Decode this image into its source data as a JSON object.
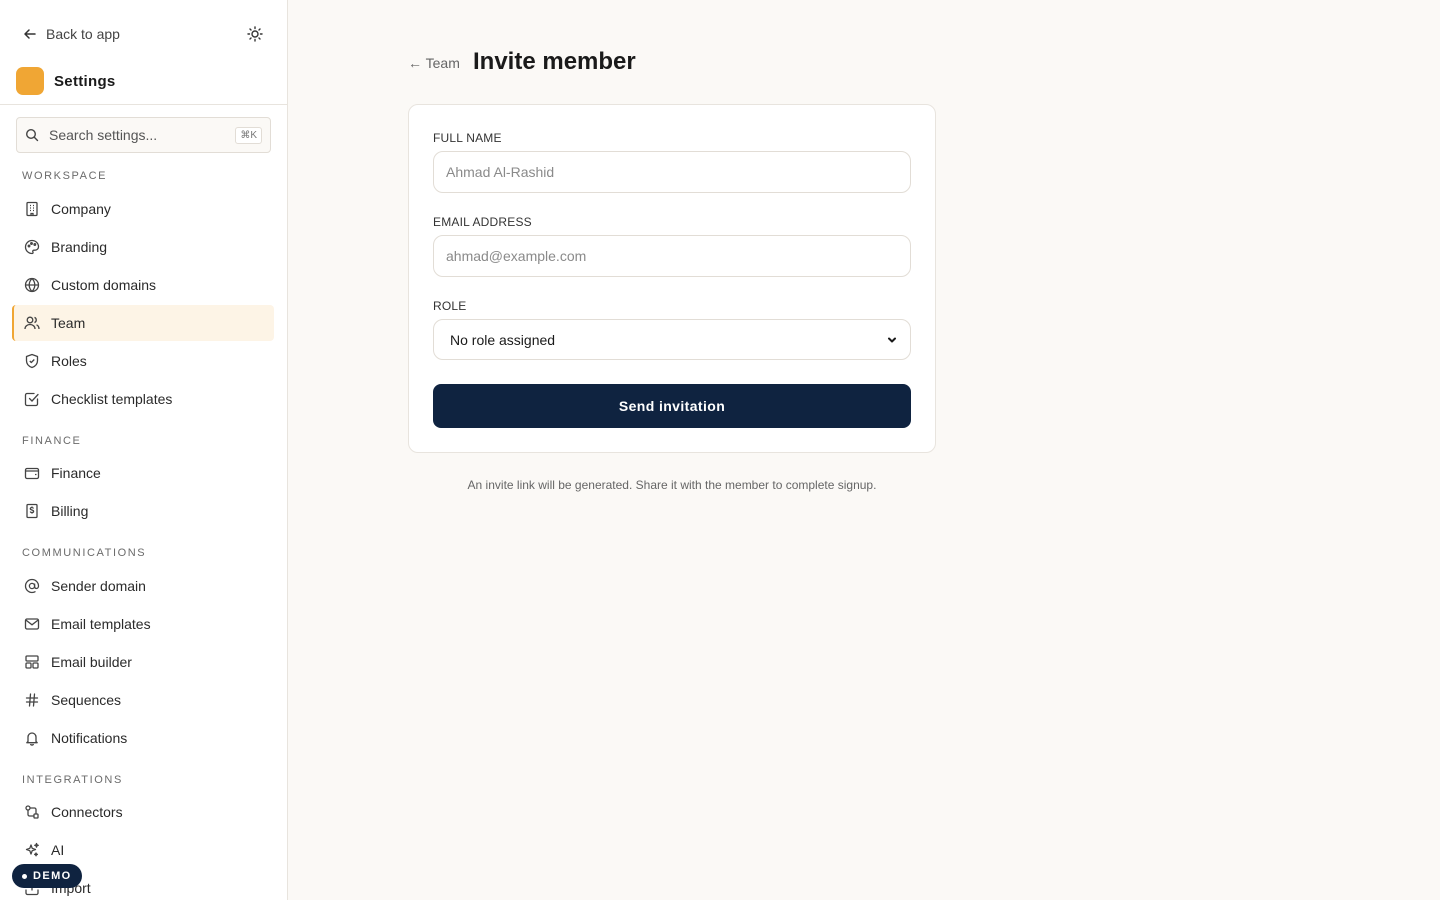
{
  "sidebar": {
    "back_label": "Back to app",
    "brand_title": "Settings",
    "search_placeholder": "Search settings...",
    "search_shortcut": "⌘K",
    "sections": [
      {
        "label": "WORKSPACE",
        "items": [
          {
            "label": "Company",
            "icon": "building-icon"
          },
          {
            "label": "Branding",
            "icon": "palette-icon"
          },
          {
            "label": "Custom domains",
            "icon": "globe-icon"
          },
          {
            "label": "Team",
            "icon": "users-icon",
            "active": true
          },
          {
            "label": "Roles",
            "icon": "shield-icon"
          },
          {
            "label": "Checklist templates",
            "icon": "checkbox-icon"
          }
        ]
      },
      {
        "label": "FINANCE",
        "items": [
          {
            "label": "Finance",
            "icon": "wallet-icon"
          },
          {
            "label": "Billing",
            "icon": "receipt-icon"
          }
        ]
      },
      {
        "label": "COMMUNICATIONS",
        "items": [
          {
            "label": "Sender domain",
            "icon": "at-sign-icon"
          },
          {
            "label": "Email templates",
            "icon": "mail-icon"
          },
          {
            "label": "Email builder",
            "icon": "layout-icon"
          },
          {
            "label": "Sequences",
            "icon": "hash-icon"
          },
          {
            "label": "Notifications",
            "icon": "bell-icon"
          }
        ]
      },
      {
        "label": "INTEGRATIONS",
        "items": [
          {
            "label": "Connectors",
            "icon": "connector-icon"
          },
          {
            "label": "AI",
            "icon": "sparkles-icon"
          },
          {
            "label": "Import",
            "icon": "upload-icon"
          }
        ]
      }
    ],
    "demo_label": "DEMO"
  },
  "main": {
    "breadcrumb": "← Team",
    "title": "Invite member",
    "form": {
      "full_name_label": "FULL NAME",
      "full_name_placeholder": "Ahmad Al-Rashid",
      "email_label": "EMAIL ADDRESS",
      "email_placeholder": "ahmad@example.com",
      "role_label": "ROLE",
      "role_value": "No role assigned",
      "submit_label": "Send invitation"
    },
    "hint": "An invite link will be generated. Share it with the member to complete signup."
  },
  "colors": {
    "accent": "#f0a634",
    "primary": "#0f2340",
    "background": "#fbf9f6"
  }
}
